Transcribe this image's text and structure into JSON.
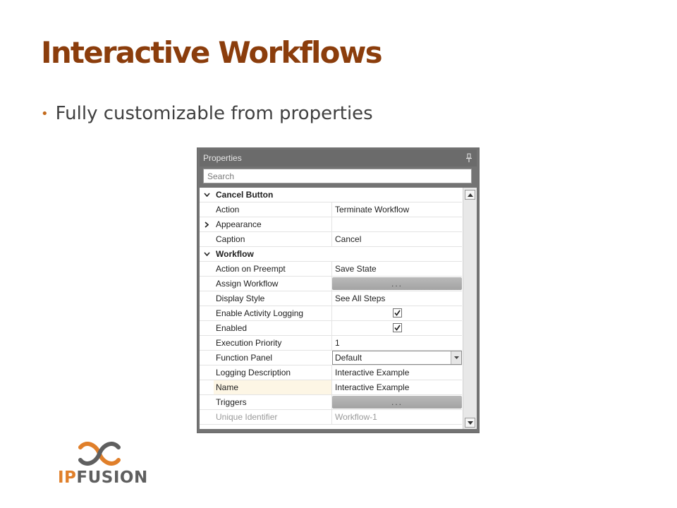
{
  "slide": {
    "title": "Interactive Workflows",
    "bullet": "Fully customizable from properties"
  },
  "panel": {
    "title": "Properties",
    "search_placeholder": "Search",
    "rows": [
      {
        "type": "category",
        "label": "Cancel Button",
        "expanded": true
      },
      {
        "type": "property",
        "name": "Action",
        "value": "Terminate Workflow"
      },
      {
        "type": "group",
        "name": "Appearance",
        "expanded": false,
        "value": ""
      },
      {
        "type": "property",
        "name": "Caption",
        "value": "Cancel"
      },
      {
        "type": "category",
        "label": "Workflow",
        "expanded": true
      },
      {
        "type": "property",
        "name": "Action on Preempt",
        "value": "Save State"
      },
      {
        "type": "button",
        "name": "Assign Workflow",
        "value": "..."
      },
      {
        "type": "property",
        "name": "Display Style",
        "value": "See All Steps"
      },
      {
        "type": "checkbox",
        "name": "Enable Activity Logging",
        "checked": true
      },
      {
        "type": "checkbox",
        "name": "Enabled",
        "checked": true
      },
      {
        "type": "property",
        "name": "Execution Priority",
        "value": "1"
      },
      {
        "type": "dropdown",
        "name": "Function Panel",
        "value": "Default"
      },
      {
        "type": "property",
        "name": "Logging Description",
        "value": "Interactive Example"
      },
      {
        "type": "property",
        "name": "Name",
        "value": "Interactive Example",
        "selected": true
      },
      {
        "type": "button",
        "name": "Triggers",
        "value": "..."
      },
      {
        "type": "property",
        "name": "Unique Identifier",
        "value": "Workflow-1",
        "disabled": true
      }
    ]
  },
  "logo": {
    "part1": "IP",
    "part2": "FUSION",
    "colors": {
      "accent": "#e07f2a",
      "gray": "#5f5f5f"
    }
  },
  "colors": {
    "title": "#8b3d0c",
    "bullet_dot": "#c36a1c",
    "panel_frame": "#737373"
  },
  "icons": [
    "pin-icon",
    "chevron-down-icon",
    "chevron-right-icon",
    "checkmark-icon",
    "scroll-up-icon",
    "scroll-down-icon",
    "dropdown-arrow-icon",
    "ipfusion-logo-mark"
  ]
}
